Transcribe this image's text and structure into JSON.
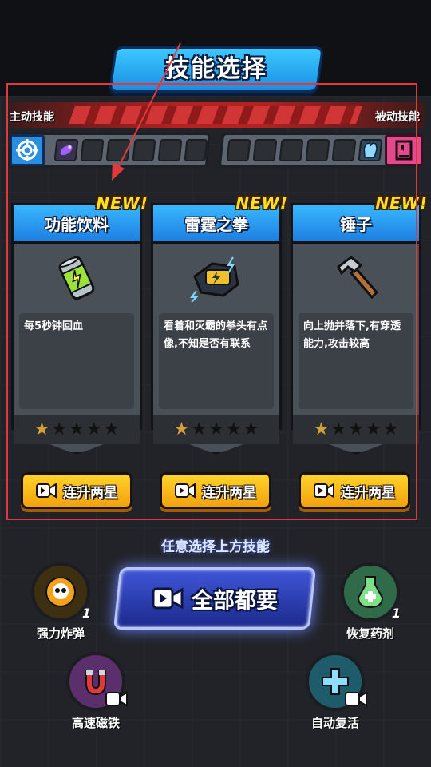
{
  "screen": {
    "title": "技能选择"
  },
  "slots": {
    "active_label": "主动技能",
    "passive_label": "被动技能",
    "active_count": 6,
    "passive_count": 6
  },
  "cards": [
    {
      "badge": "NEW!",
      "name": "功能饮料",
      "icon": "energy-drink-icon",
      "description": "每5秒钟回血",
      "stars_filled": 1,
      "stars_total": 5,
      "button_label": "连升两星"
    },
    {
      "badge": "NEW!",
      "name": "雷霆之拳",
      "icon": "thunder-fist-icon",
      "description": "看着和灭霸的拳头有点像,不知是否有联系",
      "stars_filled": 1,
      "stars_total": 5,
      "button_label": "连升两星"
    },
    {
      "badge": "NEW!",
      "name": "锤子",
      "icon": "hammer-icon",
      "description": "向上抛并落下,有穿透能力,攻击较高",
      "stars_filled": 1,
      "stars_total": 5,
      "button_label": "连升两星"
    }
  ],
  "footer": {
    "hint": "任意选择上方技能",
    "take_all_label": "全部都要"
  },
  "corner_skills": [
    {
      "name": "强力炸弹",
      "level": "1",
      "icon": "skull-bomb-icon"
    },
    {
      "name": "恢复药剂",
      "level": "1",
      "icon": "potion-icon"
    },
    {
      "name": "高速磁铁",
      "icon": "magnet-icon"
    },
    {
      "name": "自动复活",
      "icon": "revive-cross-icon"
    }
  ],
  "colors": {
    "card_header": "#2a96f0",
    "button_yellow": "#f8bf1c",
    "annotation": "#e0393b",
    "star_on": "#d4a23a"
  }
}
